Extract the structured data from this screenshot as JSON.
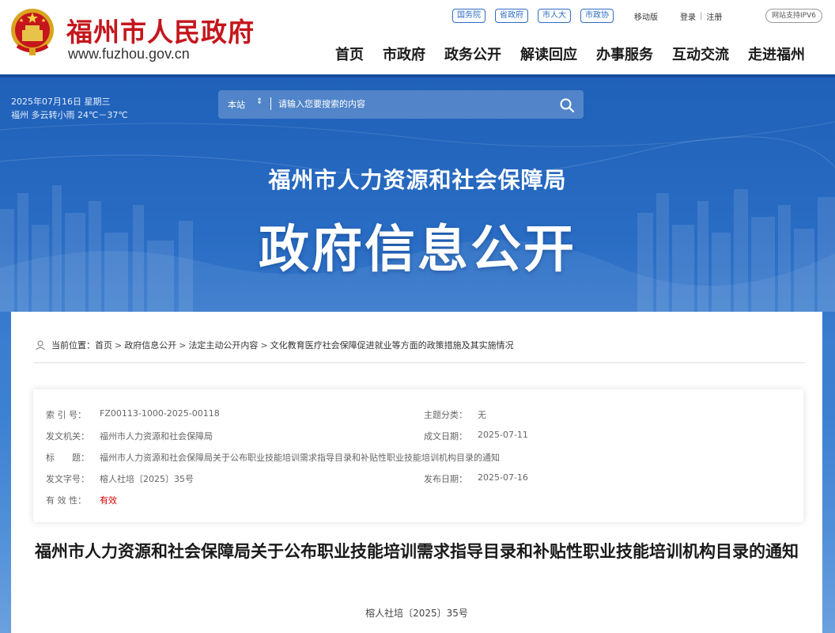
{
  "header": {
    "site_name": "福州市人民政府",
    "site_url": "www.fuzhou.gov.cn",
    "top_links": [
      "国务院",
      "省政府",
      "市人大",
      "市政协"
    ],
    "util_links": {
      "mobile": "移动版",
      "login": "登录",
      "separator": "|",
      "register": "注册"
    },
    "ipv6_badge": "网站支持IPV6",
    "nav": [
      "首页",
      "市政府",
      "政务公开",
      "解读回应",
      "办事服务",
      "互动交流",
      "走进福州"
    ]
  },
  "banner": {
    "date": "2025年07月16日 星期三",
    "weather": "福州 多云转小雨 24℃－37℃",
    "search": {
      "scope": "本站",
      "scope_caret": "⇕",
      "placeholder": "请输入您要搜索的内容"
    },
    "bureau": "福州市人力资源和社会保障局",
    "headline": "政府信息公开"
  },
  "breadcrumb": {
    "label": "当前位置：",
    "items": [
      "首页",
      "政府信息公开",
      "法定主动公开内容",
      "文化教育医疗社会保障促进就业等方面的政策措施及其实施情况"
    ],
    "separator": ">"
  },
  "meta": {
    "index_label": "索 引 号：",
    "index_value": "FZ00113-1000-2025-00118",
    "topic_label": "主题分类：",
    "topic_value": "无",
    "issuer_label": "发文机关：",
    "issuer_value": "福州市人力资源和社会保障局",
    "date_label": "成文日期：",
    "date_value": "2025-07-11",
    "title_label": "标　　题：",
    "title_value": "福州市人力资源和社会保障局关于公布职业技能培训需求指导目录和补贴性职业技能培训机构目录的通知",
    "docno_label": "发文字号：",
    "docno_value": "榕人社培〔2025〕35号",
    "pubdate_label": "发布日期：",
    "pubdate_value": "2025-07-16",
    "validity_label": "有 效 性：",
    "validity_value": "有效"
  },
  "document": {
    "title": "福州市人力资源和社会保障局关于公布职业技能培训需求指导目录和补贴性职业技能培训机构目录的通知",
    "number": "榕人社培〔2025〕35号"
  },
  "colors": {
    "brand_red": "#c4161c",
    "banner_blue": "#2a6dc4",
    "link_blue": "#2e6cc4",
    "valid_red": "#e00000"
  },
  "icons": [
    "national-emblem-icon",
    "search-icon",
    "location-icon"
  ]
}
